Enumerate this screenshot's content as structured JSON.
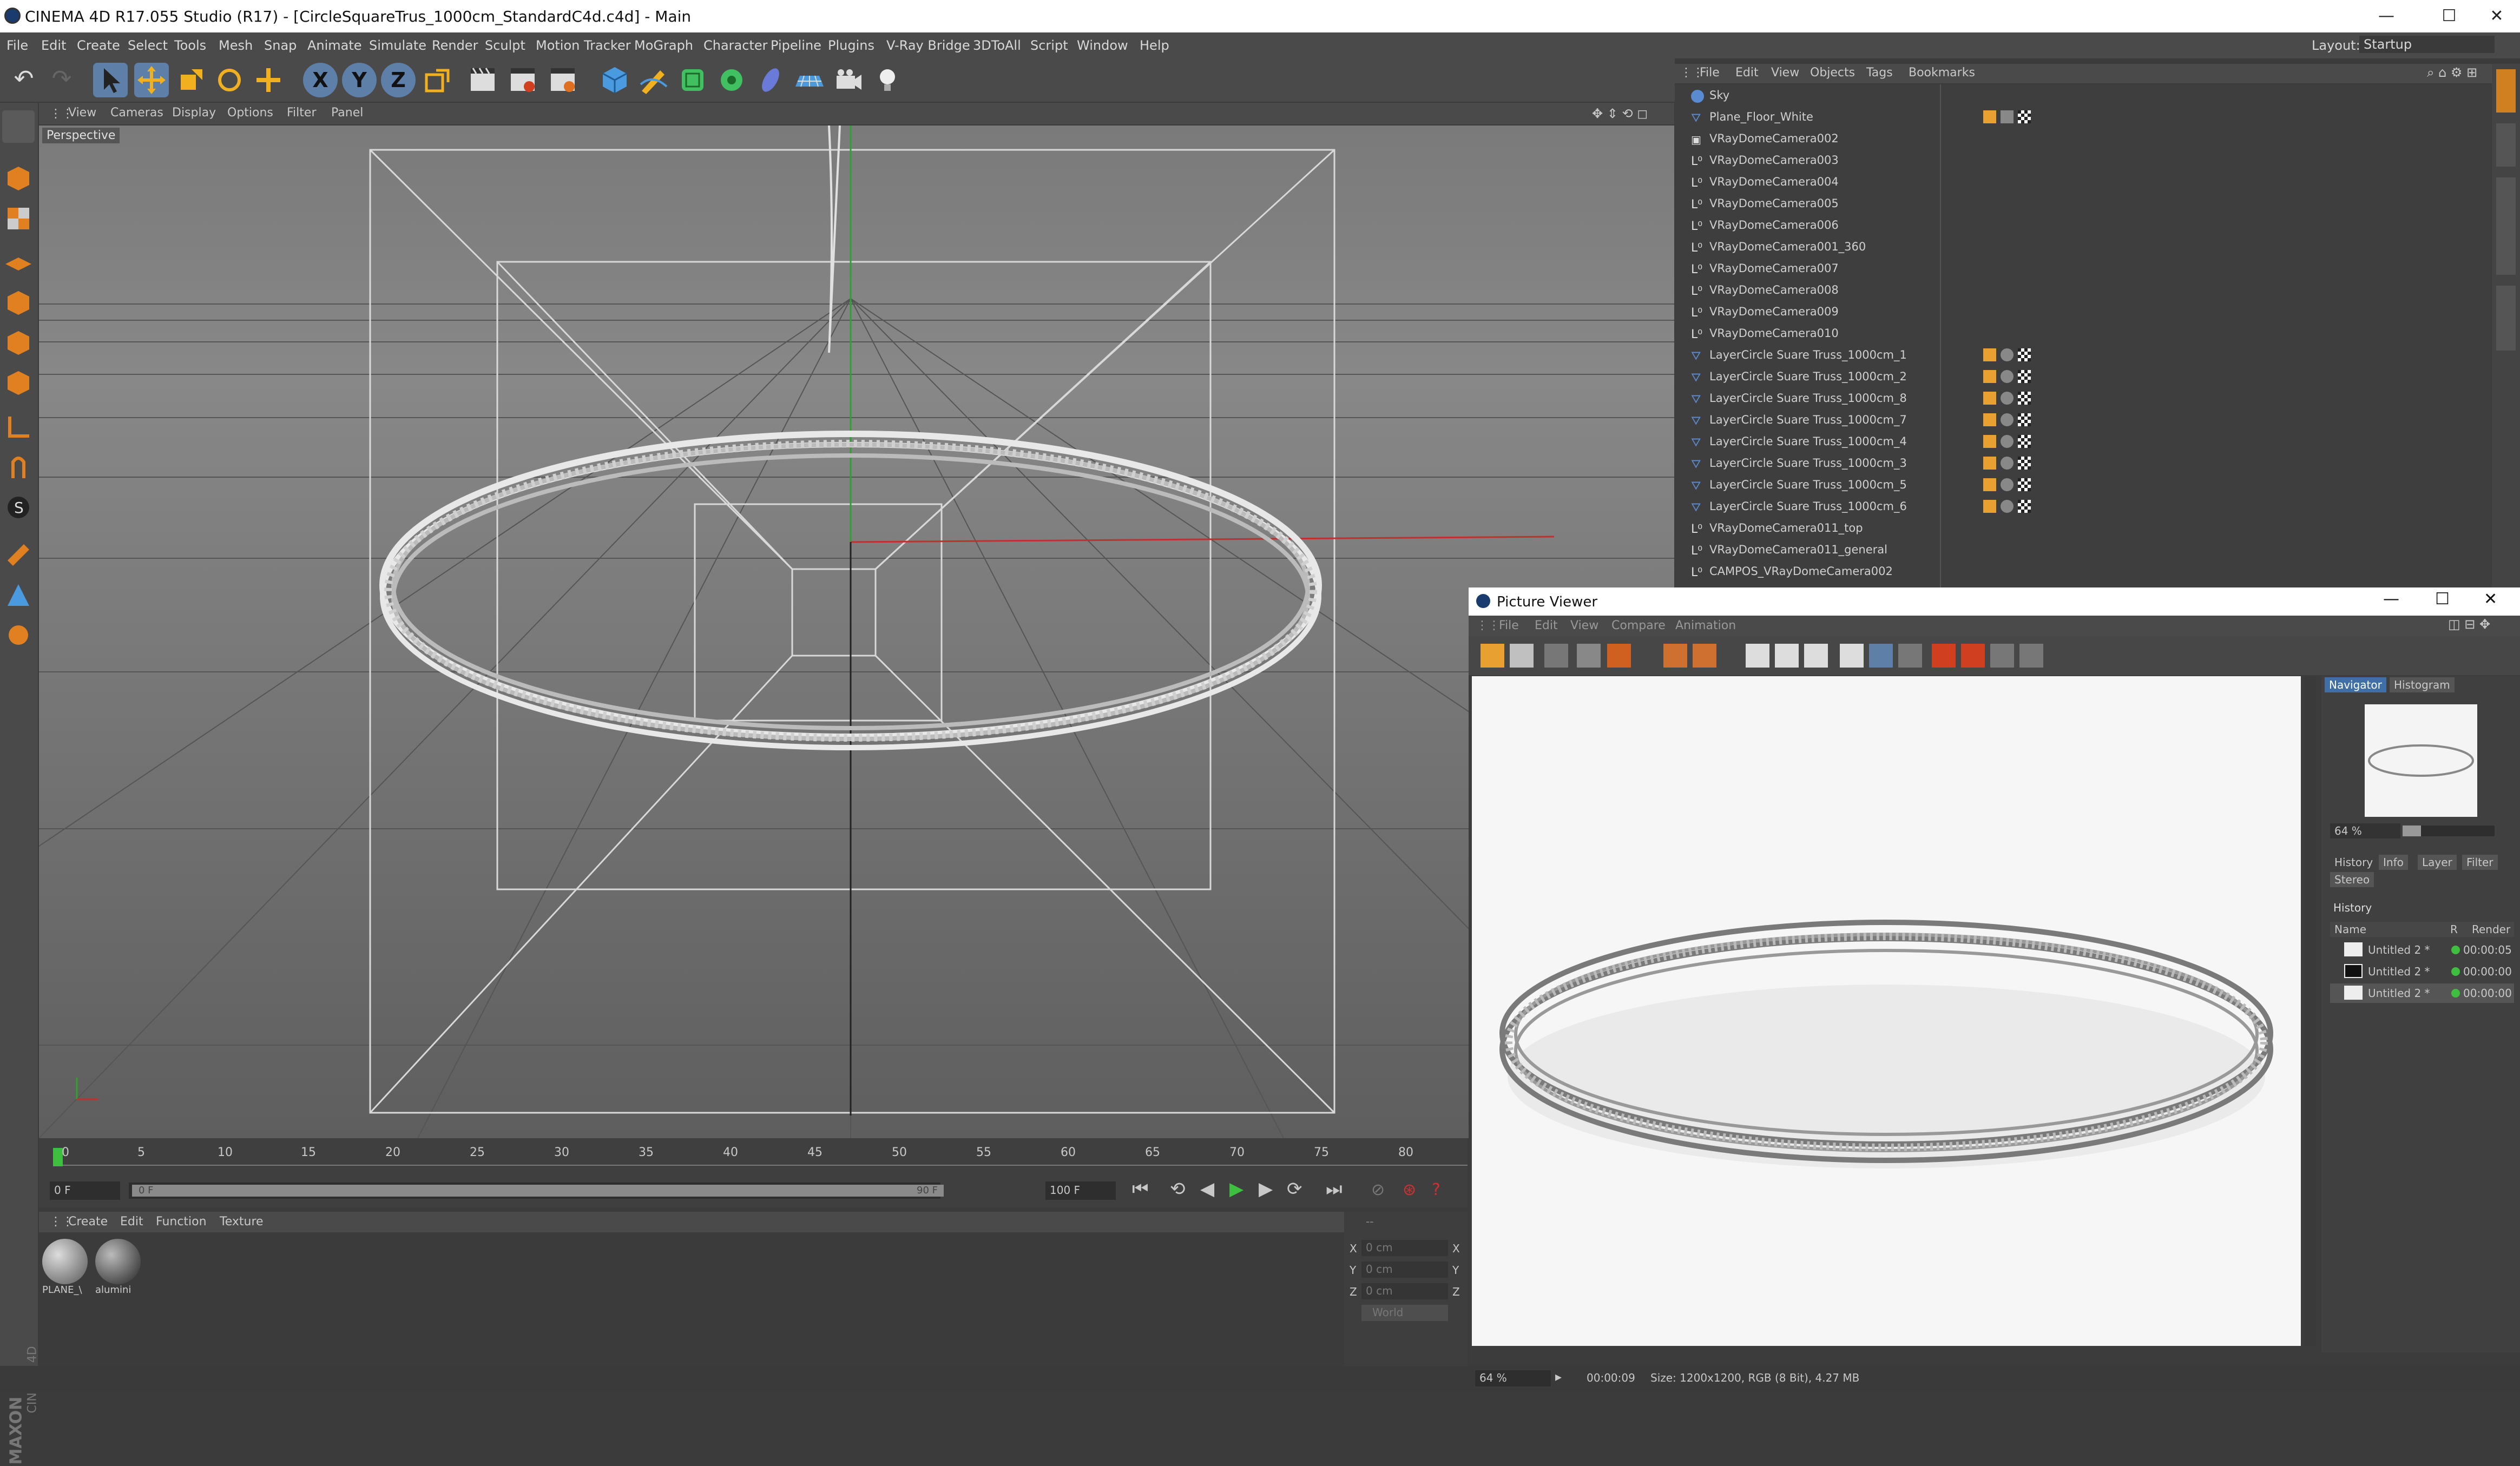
{
  "window": {
    "title": "CINEMA 4D R17.055 Studio (R17) - [CircleSquareTrus_1000cm_StandardC4d.c4d] - Main",
    "minimize": "—",
    "maximize": "☐",
    "close": "✕"
  },
  "menubar": [
    "File",
    "Edit",
    "Create",
    "Select",
    "Tools",
    "Mesh",
    "Snap",
    "Animate",
    "Simulate",
    "Render",
    "Sculpt",
    "Motion Tracker",
    "MoGraph",
    "Character",
    "Pipeline",
    "Plugins",
    "V-Ray Bridge",
    "3DToAll",
    "Script",
    "Window",
    "Help"
  ],
  "layout": {
    "label": "Layout:",
    "value": "Startup"
  },
  "toolbar": {
    "axis": [
      "X",
      "Y",
      "Z"
    ]
  },
  "viewport": {
    "menu": [
      "View",
      "Cameras",
      "Display",
      "Options",
      "Filter",
      "Panel"
    ],
    "label": "Perspective"
  },
  "timeline": {
    "ticks": [
      "0",
      "5",
      "10",
      "15",
      "20",
      "25",
      "30",
      "35",
      "40",
      "45",
      "50",
      "55",
      "60",
      "65",
      "70",
      "75",
      "80"
    ],
    "current_frame": "0 F",
    "range_start": "0 F",
    "range_end": "90 F",
    "end_frame": "100 F"
  },
  "materials": {
    "menu": [
      "Create",
      "Edit",
      "Function",
      "Texture"
    ],
    "items": [
      "PLANE_\\",
      "alumini"
    ]
  },
  "coords": {
    "rows": [
      {
        "axis": "X",
        "value": "0 cm",
        "axis2": "X"
      },
      {
        "axis": "Y",
        "value": "0 cm",
        "axis2": "Y"
      },
      {
        "axis": "Z",
        "value": "0 cm",
        "axis2": "Z"
      }
    ],
    "mode": "World",
    "dash": "--"
  },
  "object_manager": {
    "menu": [
      "File",
      "Edit",
      "View",
      "Objects",
      "Tags",
      "Bookmarks"
    ],
    "objects": [
      {
        "name": "Sky",
        "icon": "sky-icon"
      },
      {
        "name": "Plane_Floor_White",
        "icon": "plane-icon"
      },
      {
        "name": "VRayDomeCamera002",
        "icon": "camera-icon"
      },
      {
        "name": "VRayDomeCamera003",
        "icon": "null-icon"
      },
      {
        "name": "VRayDomeCamera004",
        "icon": "null-icon"
      },
      {
        "name": "VRayDomeCamera005",
        "icon": "null-icon"
      },
      {
        "name": "VRayDomeCamera006",
        "icon": "null-icon"
      },
      {
        "name": "VRayDomeCamera001_360",
        "icon": "null-icon"
      },
      {
        "name": "VRayDomeCamera007",
        "icon": "null-icon"
      },
      {
        "name": "VRayDomeCamera008",
        "icon": "null-icon"
      },
      {
        "name": "VRayDomeCamera009",
        "icon": "null-icon"
      },
      {
        "name": "VRayDomeCamera010",
        "icon": "null-icon"
      },
      {
        "name": "LayerCircle Suare Truss_1000cm_1",
        "icon": "layer-icon"
      },
      {
        "name": "LayerCircle Suare Truss_1000cm_2",
        "icon": "layer-icon"
      },
      {
        "name": "LayerCircle Suare Truss_1000cm_8",
        "icon": "layer-icon"
      },
      {
        "name": "LayerCircle Suare Truss_1000cm_7",
        "icon": "layer-icon"
      },
      {
        "name": "LayerCircle Suare Truss_1000cm_4",
        "icon": "layer-icon"
      },
      {
        "name": "LayerCircle Suare Truss_1000cm_3",
        "icon": "layer-icon"
      },
      {
        "name": "LayerCircle Suare Truss_1000cm_5",
        "icon": "layer-icon"
      },
      {
        "name": "LayerCircle Suare Truss_1000cm_6",
        "icon": "layer-icon"
      },
      {
        "name": "VRayDomeCamera011_top",
        "icon": "null-icon"
      },
      {
        "name": "VRayDomeCamera011_general",
        "icon": "null-icon"
      },
      {
        "name": "CAMPOS_VRayDomeCamera002",
        "icon": "null-icon"
      }
    ]
  },
  "picture_viewer": {
    "title": "Picture Viewer",
    "menu": [
      "File",
      "Edit",
      "View",
      "Compare",
      "Animation"
    ],
    "tabs_top": [
      "Navigator",
      "Histogram"
    ],
    "zoom": "64 %",
    "tabs_mid": [
      "History",
      "Info",
      "Layer",
      "Filter"
    ],
    "stereo": "Stereo",
    "history_title": "History",
    "columns": [
      "Name",
      "R",
      "Render"
    ],
    "rows": [
      {
        "name": "Untitled 2 *",
        "time": "00:00:05"
      },
      {
        "name": "Untitled 2 *",
        "time": "00:00:00"
      },
      {
        "name": "Untitled 2 *",
        "time": "00:00:00"
      }
    ],
    "status_zoom": "64 %",
    "status_time": "00:00:09",
    "status_size": "Size: 1200x1200, RGB (8 Bit), 4.27 MB"
  },
  "brand": {
    "maxon": "MAXON",
    "c4d": "CINEMA 4D"
  },
  "colors": {
    "accent": "#3f6fa6",
    "axis_x": "#c03030",
    "axis_y": "#30a030"
  }
}
